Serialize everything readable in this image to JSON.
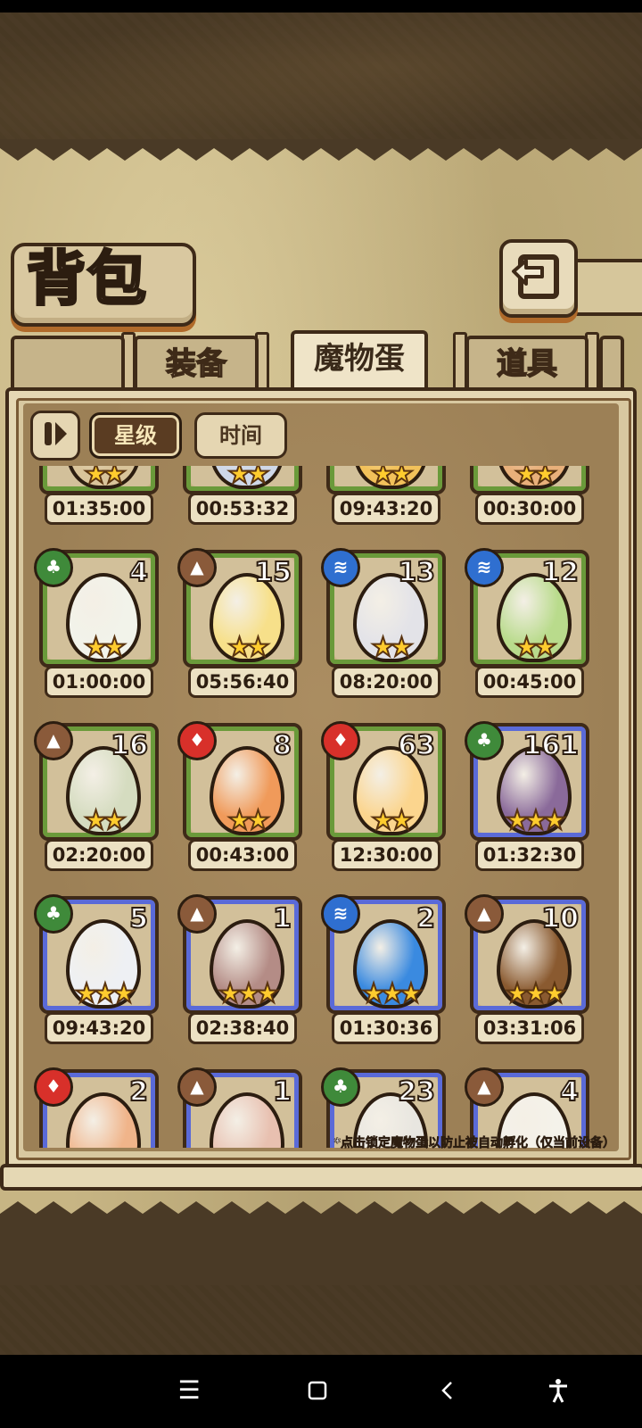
{
  "title": "背包",
  "tabs": [
    {
      "label": "装备",
      "active": false
    },
    {
      "label": "魔物蛋",
      "active": true
    },
    {
      "label": "道具",
      "active": false
    }
  ],
  "sort": {
    "star_label": "星级",
    "time_label": "时间",
    "selected": "星级"
  },
  "note": "*点击锁定魔物蛋以防止被自动孵化（仅当前设备）",
  "colors": {
    "grass": "#3f8a3a",
    "rock": "#8a5a3a",
    "water": "#2f6fd0",
    "fire": "#d8302a",
    "frame_green": "#6a9a3a",
    "frame_blue": "#5a6ad8"
  },
  "eggs": [
    {
      "count": "",
      "stars": "★★",
      "timer": "01:35:00",
      "element": "",
      "frame": "green",
      "egg_color": "#d9c49a"
    },
    {
      "count": "",
      "stars": "★★",
      "timer": "00:53:32",
      "element": "",
      "frame": "green",
      "egg_color": "#cfd8e8"
    },
    {
      "count": "",
      "stars": "★★",
      "timer": "09:43:20",
      "element": "",
      "frame": "green",
      "egg_color": "#f2c15a"
    },
    {
      "count": "",
      "stars": "★★",
      "timer": "00:30:00",
      "element": "",
      "frame": "green",
      "egg_color": "#e8b07a"
    },
    {
      "count": "4",
      "stars": "★★",
      "timer": "01:00:00",
      "element": "grass",
      "frame": "green",
      "egg_color": "#f2f3ea"
    },
    {
      "count": "15",
      "stars": "★★",
      "timer": "05:56:40",
      "element": "rock",
      "frame": "green",
      "egg_color": "#f7e08a"
    },
    {
      "count": "13",
      "stars": "★★",
      "timer": "08:20:00",
      "element": "water",
      "frame": "green",
      "egg_color": "#e3e3e8"
    },
    {
      "count": "12",
      "stars": "★★",
      "timer": "00:45:00",
      "element": "water",
      "frame": "green",
      "egg_color": "#b9db8c"
    },
    {
      "count": "16",
      "stars": "★★",
      "timer": "02:20:00",
      "element": "rock",
      "frame": "green",
      "egg_color": "#d5dcc0"
    },
    {
      "count": "8",
      "stars": "★★",
      "timer": "00:43:00",
      "element": "fire",
      "frame": "green",
      "egg_color": "#f09a5a"
    },
    {
      "count": "63",
      "stars": "★★",
      "timer": "12:30:00",
      "element": "fire",
      "frame": "green",
      "egg_color": "#fbd58e"
    },
    {
      "count": "161",
      "stars": "★★★",
      "timer": "01:32:30",
      "element": "grass",
      "frame": "blue",
      "egg_color": "#8a6a9a"
    },
    {
      "count": "5",
      "stars": "★★★",
      "timer": "09:43:20",
      "element": "grass",
      "frame": "blue",
      "egg_color": "#eef0f4"
    },
    {
      "count": "1",
      "stars": "★★★",
      "timer": "02:38:40",
      "element": "rock",
      "frame": "blue",
      "egg_color": "#b48c86"
    },
    {
      "count": "2",
      "stars": "★★★",
      "timer": "01:30:36",
      "element": "water",
      "frame": "blue",
      "egg_color": "#3a8ae0"
    },
    {
      "count": "10",
      "stars": "★★★",
      "timer": "03:31:06",
      "element": "rock",
      "frame": "blue",
      "egg_color": "#8a5a30"
    },
    {
      "count": "2",
      "stars": "",
      "timer": "",
      "element": "fire",
      "frame": "blue",
      "egg_color": "#f0b48a"
    },
    {
      "count": "1",
      "stars": "",
      "timer": "",
      "element": "rock",
      "frame": "blue",
      "egg_color": "#e8c0b0"
    },
    {
      "count": "23",
      "stars": "",
      "timer": "",
      "element": "grass",
      "frame": "blue",
      "egg_color": "#e8e6e0"
    },
    {
      "count": "4",
      "stars": "",
      "timer": "",
      "element": "rock",
      "frame": "blue",
      "egg_color": "#f4f2ea"
    }
  ]
}
